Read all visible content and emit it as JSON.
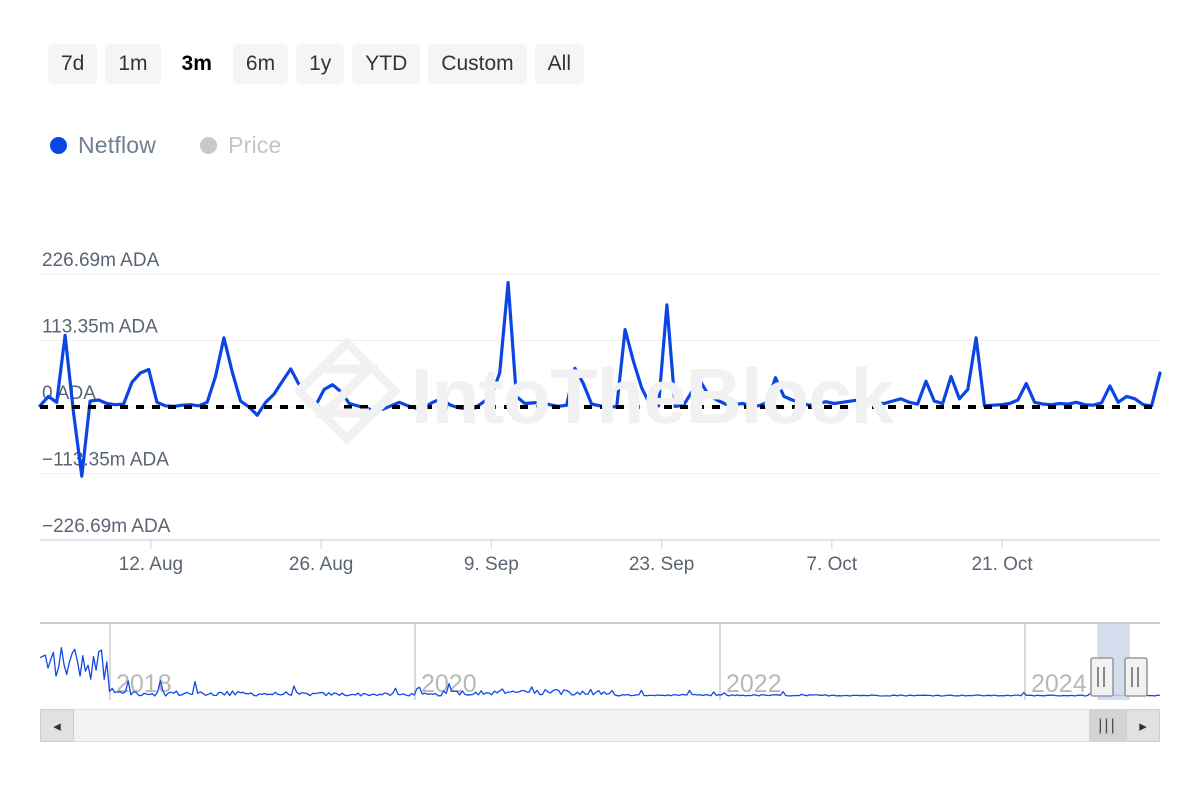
{
  "range_selector": {
    "buttons": [
      {
        "label": "7d",
        "selected": false
      },
      {
        "label": "1m",
        "selected": false
      },
      {
        "label": "3m",
        "selected": true
      },
      {
        "label": "6m",
        "selected": false
      },
      {
        "label": "1y",
        "selected": false
      },
      {
        "label": "YTD",
        "selected": false
      },
      {
        "label": "Custom",
        "selected": false
      },
      {
        "label": "All",
        "selected": false
      }
    ]
  },
  "legend": {
    "items": [
      {
        "label": "Netflow",
        "color": "#0b46e5",
        "active": true
      },
      {
        "label": "Price",
        "color": "#c9c9c9",
        "active": false
      }
    ]
  },
  "watermark": {
    "text": "IntoTheBlock",
    "logo": "intotheblock-diamond-logo",
    "color": "#f1f1f1"
  },
  "navigator": {
    "year_labels": [
      "2018",
      "2020",
      "2022",
      "2024"
    ],
    "selection": {
      "start_pct": 94.4,
      "end_pct": 97.3
    },
    "left_arrow": "◂",
    "right_arrow": "▸",
    "thumb_grip": "|||"
  },
  "chart_data": {
    "type": "line",
    "title": "",
    "xlabel": "",
    "ylabel": "",
    "unit": "ADA",
    "series_name": "Netflow",
    "series_color": "#0b46e5",
    "zero_line": {
      "value": 0,
      "style": "dashed",
      "color": "#000000"
    },
    "grid": true,
    "legend_position": "top-left",
    "ylim": [
      -226.69,
      226.69
    ],
    "y_ticks": [
      226.69,
      113.35,
      0,
      -113.35,
      -226.69
    ],
    "y_tick_labels": [
      "226.69m ADA",
      "113.35m ADA",
      "0 ADA",
      "−113.35m ADA",
      "−226.69m ADA"
    ],
    "x_tick_labels": [
      "12. Aug",
      "26. Aug",
      "9. Sep",
      "23. Sep",
      "7. Oct",
      "21. Oct"
    ],
    "x_tick_positions_pct": [
      9.9,
      25.1,
      40.3,
      55.5,
      70.7,
      85.9
    ],
    "values": [
      2,
      18,
      8,
      122,
      -8,
      -118,
      10,
      12,
      6,
      4,
      5,
      42,
      58,
      64,
      8,
      2,
      1,
      3,
      4,
      2,
      8,
      52,
      118,
      60,
      10,
      0,
      -14,
      8,
      22,
      44,
      65,
      38,
      12,
      3,
      30,
      38,
      26,
      6,
      2,
      -2,
      -6,
      -4,
      2,
      8,
      2,
      -2,
      0,
      8,
      14,
      4,
      -1,
      -3,
      -2,
      8,
      18,
      58,
      212,
      18,
      6,
      7,
      8,
      4,
      1,
      3,
      66,
      40,
      5,
      2,
      1,
      0,
      132,
      78,
      32,
      4,
      2,
      174,
      1,
      3,
      26,
      44,
      20,
      12,
      5,
      4,
      6,
      3,
      2,
      8,
      50,
      18,
      12,
      8,
      3,
      5,
      9,
      6,
      8,
      10,
      12,
      9,
      7,
      6,
      10,
      14,
      8,
      5,
      44,
      10,
      6,
      52,
      14,
      30,
      118,
      2,
      3,
      4,
      6,
      12,
      40,
      8,
      5,
      4,
      6,
      5,
      8,
      4,
      3,
      7,
      36,
      8,
      18,
      14,
      4,
      2,
      58
    ],
    "y_axis_unit_note": "millions of ADA"
  }
}
